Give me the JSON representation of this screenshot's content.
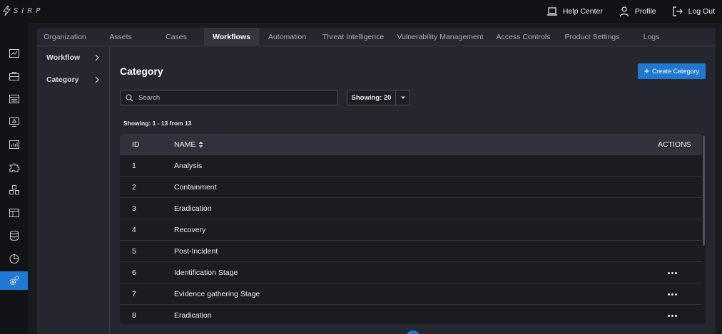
{
  "brand": {
    "name": "SIRP"
  },
  "topbar": {
    "help_center": "Help Center",
    "profile": "Profile",
    "logout": "Log Out"
  },
  "rail": {
    "items": [
      {
        "icon": "dashboard-icon"
      },
      {
        "icon": "briefcase-icon"
      },
      {
        "icon": "list-icon"
      },
      {
        "icon": "monitor-alert-icon"
      },
      {
        "icon": "chart-icon"
      },
      {
        "icon": "puzzle-icon"
      },
      {
        "icon": "cubes-icon"
      },
      {
        "icon": "board-icon"
      },
      {
        "icon": "database-icon"
      },
      {
        "icon": "pie-chart-icon"
      },
      {
        "icon": "gears-icon",
        "active": true
      }
    ]
  },
  "tabs": [
    {
      "label": "Organization"
    },
    {
      "label": "Assets"
    },
    {
      "label": "Cases"
    },
    {
      "label": "Workflows",
      "active": true
    },
    {
      "label": "Automation"
    },
    {
      "label": "Threat Intelligence"
    },
    {
      "label": "Vulnerability Management"
    },
    {
      "label": "Access Controls"
    },
    {
      "label": "Product Settings"
    },
    {
      "label": "Logs"
    }
  ],
  "subnav": [
    {
      "label": "Workflow"
    },
    {
      "label": "Category"
    }
  ],
  "page": {
    "title": "Category",
    "create_button": "Create Category",
    "search_placeholder": "Search",
    "showing_select": "Showing: 20",
    "count_text": "Showing: 1 - 13 from 13"
  },
  "table": {
    "columns": {
      "id": "ID",
      "name": "NAME",
      "actions": "ACTIONS"
    },
    "rows": [
      {
        "id": "1",
        "name": "Analysis",
        "has_actions": false
      },
      {
        "id": "2",
        "name": "Containment",
        "has_actions": false
      },
      {
        "id": "3",
        "name": "Eradication",
        "has_actions": false
      },
      {
        "id": "4",
        "name": "Recovery",
        "has_actions": false
      },
      {
        "id": "5",
        "name": "Post-Incident",
        "has_actions": false
      },
      {
        "id": "6",
        "name": "Identification Stage",
        "has_actions": true
      },
      {
        "id": "7",
        "name": "Evidence gathering Stage",
        "has_actions": true
      },
      {
        "id": "8",
        "name": "Eradication",
        "has_actions": true
      }
    ]
  },
  "colors": {
    "accent": "#1f78d1",
    "background": "#1a1b1f",
    "panel": "#26272e"
  }
}
